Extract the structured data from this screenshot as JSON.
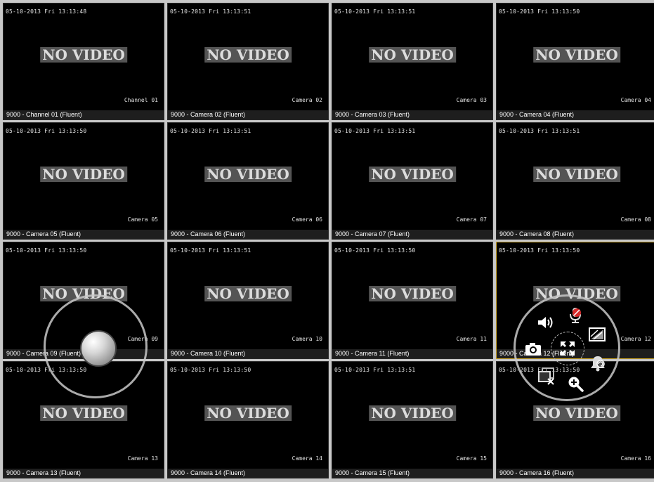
{
  "tiles": [
    {
      "timestamp": "05-10-2013 Fri 13:13:48",
      "no_video": "NO VIDEO",
      "osd_name": "Channel 01",
      "status_label": "9000 - Channel 01 (Fluent)"
    },
    {
      "timestamp": "05-10-2013 Fri 13:13:51",
      "no_video": "NO VIDEO",
      "osd_name": "Camera 02",
      "status_label": "9000 - Camera 02 (Fluent)"
    },
    {
      "timestamp": "05-10-2013 Fri 13:13:51",
      "no_video": "NO VIDEO",
      "osd_name": "Camera 03",
      "status_label": "9000 - Camera 03 (Fluent)"
    },
    {
      "timestamp": "05-10-2013 Fri 13:13:50",
      "no_video": "NO VIDEO",
      "osd_name": "Camera 04",
      "status_label": "9000 - Camera 04 (Fluent)"
    },
    {
      "timestamp": "05-10-2013 Fri 13:13:50",
      "no_video": "NO VIDEO",
      "osd_name": "Camera 05",
      "status_label": "9000 - Camera 05 (Fluent)"
    },
    {
      "timestamp": "05-10-2013 Fri 13:13:51",
      "no_video": "NO VIDEO",
      "osd_name": "Camera 06",
      "status_label": "9000 - Camera 06 (Fluent)"
    },
    {
      "timestamp": "05-10-2013 Fri 13:13:51",
      "no_video": "NO VIDEO",
      "osd_name": "Camera 07",
      "status_label": "9000 - Camera 07 (Fluent)"
    },
    {
      "timestamp": "05-10-2013 Fri 13:13:51",
      "no_video": "NO VIDEO",
      "osd_name": "Camera 08",
      "status_label": "9000 - Camera 08 (Fluent)"
    },
    {
      "timestamp": "05-10-2013 Fri 13:13:50",
      "no_video": "NO VIDEO",
      "osd_name": "Camera 09",
      "status_label": "9000 - Camera 09 (Fluent)"
    },
    {
      "timestamp": "05-10-2013 Fri 13:13:51",
      "no_video": "NO VIDEO",
      "osd_name": "Camera 10",
      "status_label": "9000 - Camera 10 (Fluent)"
    },
    {
      "timestamp": "05-10-2013 Fri 13:13:50",
      "no_video": "NO VIDEO",
      "osd_name": "Camera 11",
      "status_label": "9000 - Camera 11 (Fluent)"
    },
    {
      "timestamp": "05-10-2013 Fri 13:13:50",
      "no_video": "NO VIDEO",
      "osd_name": "Camera 12",
      "status_label": "9000 - Camera 12 (Fluent)"
    },
    {
      "timestamp": "05-10-2013 Fri 13:13:50",
      "no_video": "NO VIDEO",
      "osd_name": "Camera 13",
      "status_label": "9000 - Camera 13 (Fluent)"
    },
    {
      "timestamp": "05-10-2013 Fri 13:13:50",
      "no_video": "NO VIDEO",
      "osd_name": "Camera 14",
      "status_label": "9000 - Camera 14 (Fluent)"
    },
    {
      "timestamp": "05-10-2013 Fri 13:13:51",
      "no_video": "NO VIDEO",
      "osd_name": "Camera 15",
      "status_label": "9000 - Camera 15 (Fluent)"
    },
    {
      "timestamp": "05-10-2013 Fri 13:13:50",
      "no_video": "NO VIDEO",
      "osd_name": "Camera 16",
      "status_label": "9000 - Camera 16 (Fluent)"
    }
  ],
  "selected_tile": 12,
  "colors": {
    "selected_border": "#c9a227",
    "mic_muted": "#d62a2a"
  },
  "overlays": {
    "ptz_control": {
      "icon": "ptz-joystick-icon"
    },
    "action_menu": {
      "icons": [
        "speaker-icon",
        "mic-muted-icon",
        "image-adjust-icon",
        "camera-snapshot-icon",
        "exit-fullscreen-icon",
        "alarm-bell-icon",
        "close-window-icon",
        "zoom-in-icon"
      ]
    }
  }
}
